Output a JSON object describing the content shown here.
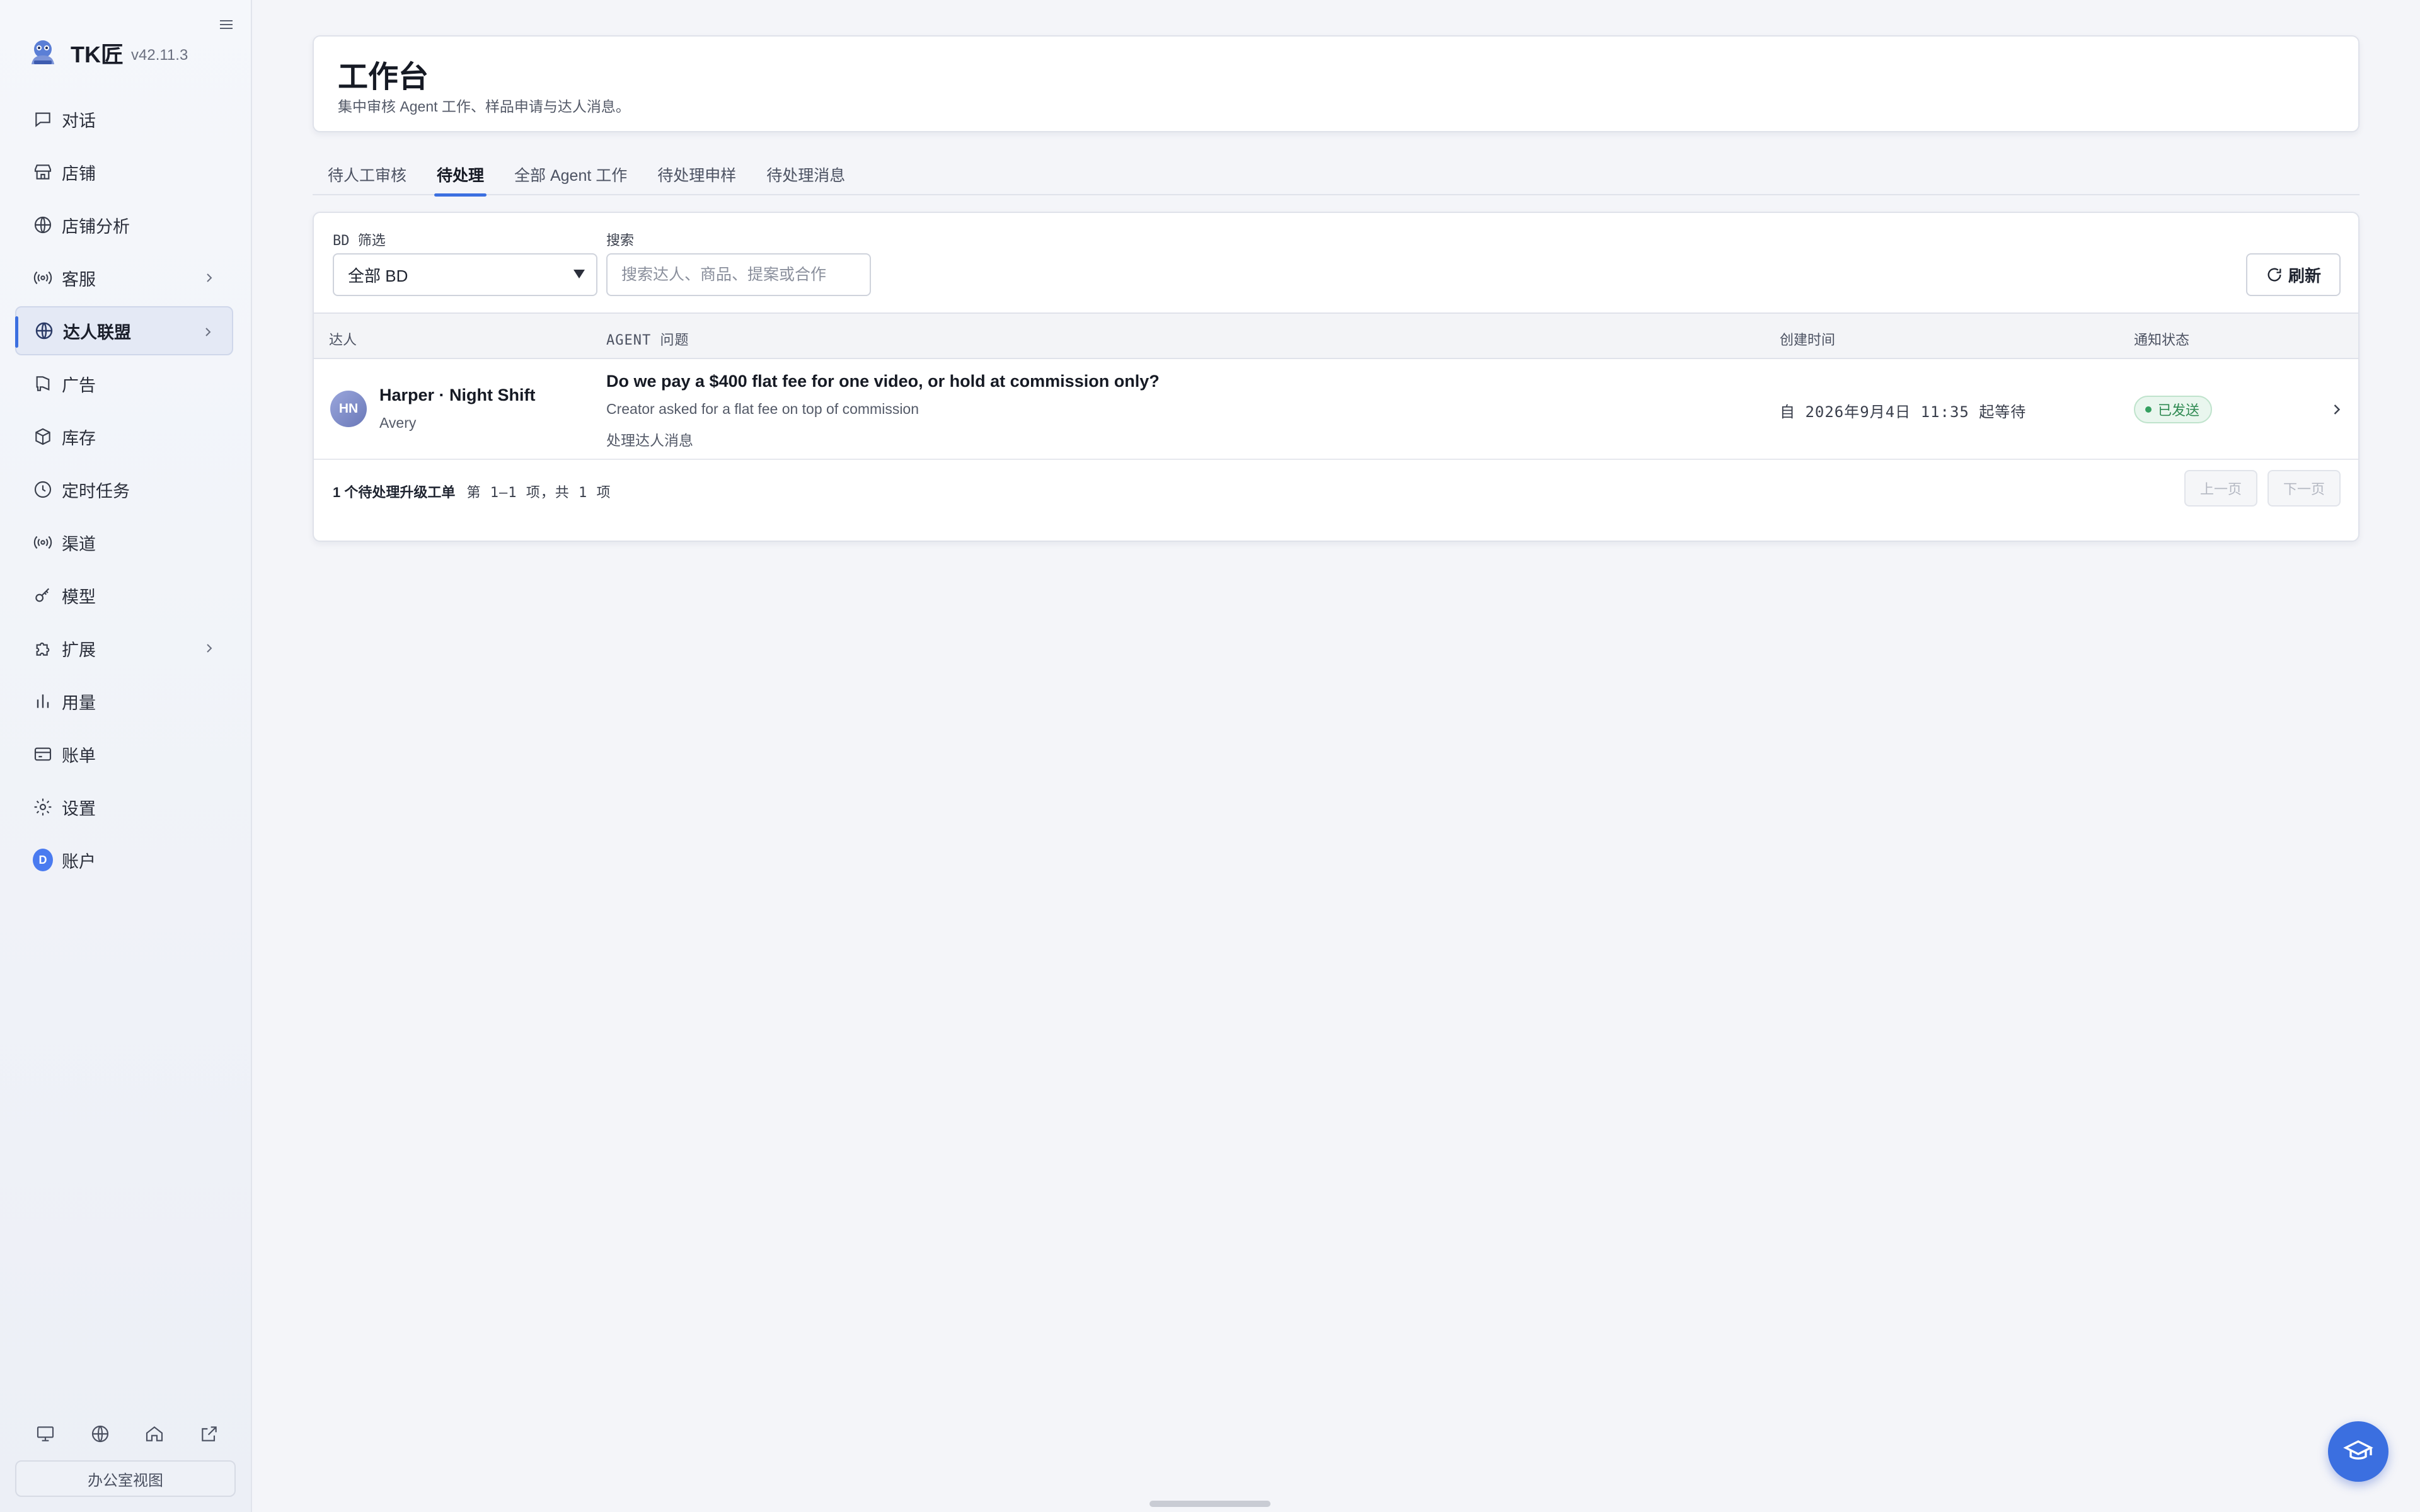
{
  "brand": {
    "name": "TK匠",
    "version": "v42.11.3"
  },
  "sidebar": {
    "items": [
      {
        "label": "对话",
        "icon": "chat-icon"
      },
      {
        "label": "店铺",
        "icon": "store-icon"
      },
      {
        "label": "店铺分析",
        "icon": "globe-icon"
      },
      {
        "label": "客服",
        "icon": "broadcast-icon"
      },
      {
        "label": "达人联盟",
        "icon": "globe-icon",
        "active": true
      },
      {
        "label": "广告",
        "icon": "megaphone-icon"
      },
      {
        "label": "库存",
        "icon": "box-icon"
      },
      {
        "label": "定时任务",
        "icon": "clock-icon"
      },
      {
        "label": "渠道",
        "icon": "broadcast-icon"
      },
      {
        "label": "模型",
        "icon": "key-icon"
      },
      {
        "label": "扩展",
        "icon": "puzzle-icon"
      },
      {
        "label": "用量",
        "icon": "bar-chart-icon"
      },
      {
        "label": "账单",
        "icon": "credit-card-icon"
      },
      {
        "label": "设置",
        "icon": "gear-icon"
      },
      {
        "label": "账户",
        "icon": "avatar",
        "avatar_letter": "D"
      }
    ],
    "office_view_label": "办公室视图"
  },
  "header": {
    "title": "工作台",
    "subtitle": "集中审核 Agent 工作、样品申请与达人消息。"
  },
  "tabs": [
    {
      "label": "待人工审核"
    },
    {
      "label": "待处理",
      "active": true
    },
    {
      "label": "全部 Agent 工作"
    },
    {
      "label": "待处理申样"
    },
    {
      "label": "待处理消息"
    }
  ],
  "filters": {
    "bd_label": "BD 筛选",
    "bd_selected": "全部 BD",
    "search_label": "搜索",
    "search_placeholder": "搜索达人、商品、提案或合作",
    "refresh_label": "刷新"
  },
  "table": {
    "columns": {
      "creator": "达人",
      "agent_question": "AGENT 问题",
      "created": "创建时间",
      "notify": "通知状态"
    },
    "rows": [
      {
        "initials": "HN",
        "creator_name": "Harper · Night Shift",
        "creator_sub": "Avery",
        "question_title": "Do we pay a $400 flat fee for one video, or hold at commission only?",
        "question_desc": "Creator asked for a flat fee on top of commission",
        "question_action": "处理达人消息",
        "created": "自 2026年9月4日 11:35 起等待",
        "notify_status": "已发送"
      }
    ]
  },
  "pagination": {
    "summary_bold": "1 个待处理升级工单",
    "summary_rest": "第 1–1 项，共 1 项",
    "prev_label": "上一页",
    "next_label": "下一页"
  },
  "colors": {
    "accent": "#3b6fe0",
    "status_green": "#2f8a52"
  }
}
